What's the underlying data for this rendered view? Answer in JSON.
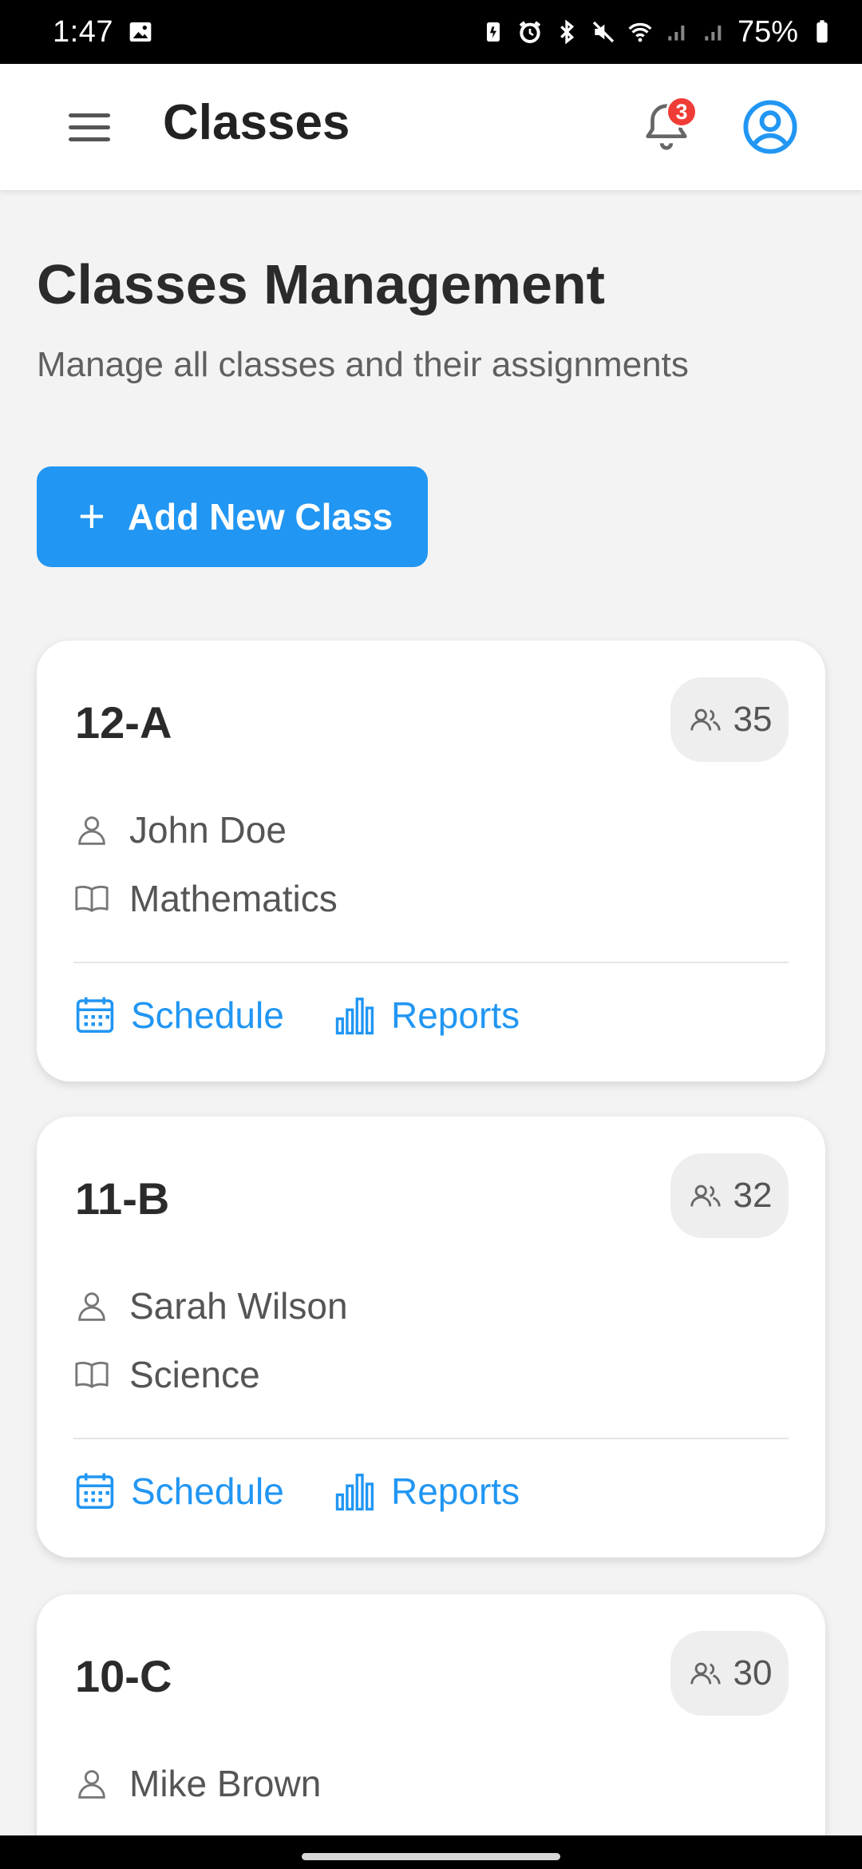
{
  "status_bar": {
    "time": "1:47",
    "battery": "75%"
  },
  "app_bar": {
    "title": "Classes",
    "notification_count": "3"
  },
  "header": {
    "title": "Classes Management",
    "subtitle": "Manage all classes and their assignments"
  },
  "add_button": {
    "label": "Add New Class"
  },
  "colors": {
    "accent": "#2196f3",
    "badge": "#f03c36",
    "background": "#f3f3f3"
  },
  "classes": [
    {
      "name": "12-A",
      "students": "35",
      "teacher": "John Doe",
      "subject": "Mathematics",
      "schedule_label": "Schedule",
      "reports_label": "Reports"
    },
    {
      "name": "11-B",
      "students": "32",
      "teacher": "Sarah Wilson",
      "subject": "Science",
      "schedule_label": "Schedule",
      "reports_label": "Reports"
    },
    {
      "name": "10-C",
      "students": "30",
      "teacher": "Mike Brown"
    }
  ],
  "icons": {
    "menu": "menu-icon",
    "notifications": "bell-icon",
    "profile": "account-circle-icon",
    "people": "people-icon",
    "teacher": "person-icon",
    "subject": "book-icon",
    "schedule": "calendar-icon",
    "reports": "bar-chart-icon"
  }
}
